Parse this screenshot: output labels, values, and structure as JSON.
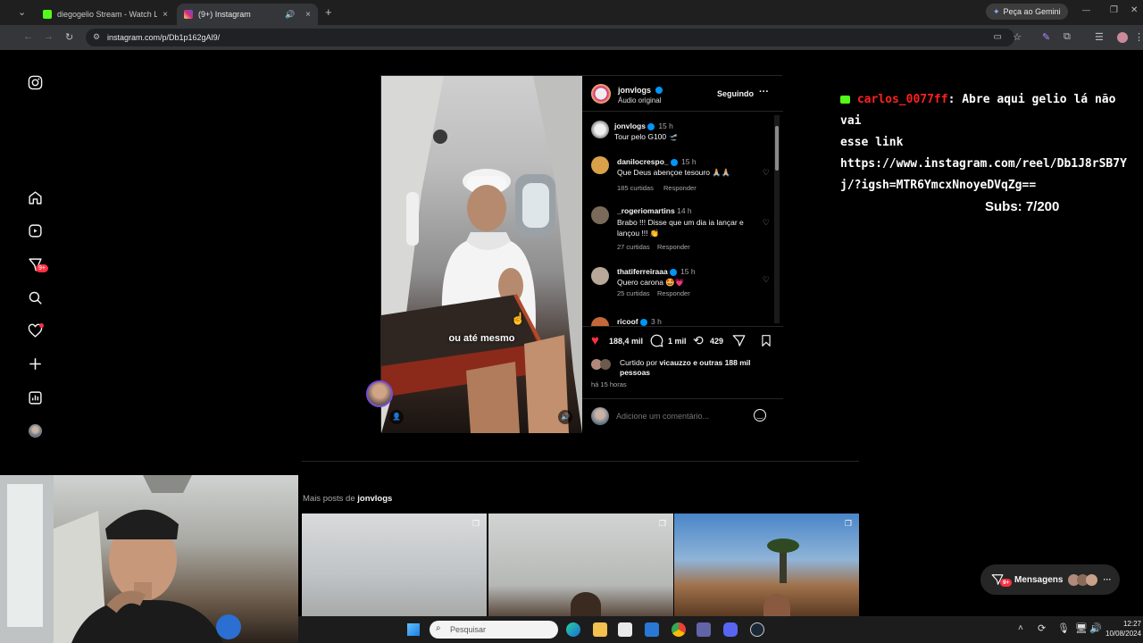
{
  "browser": {
    "tabs": [
      {
        "title": "diegogelio Stream - Watch Liv",
        "close": "×"
      },
      {
        "title": "(9+) Instagram",
        "close": "×"
      }
    ],
    "new_tab": "+",
    "gemini_button": "Peça ao Gemini",
    "url": "instagram.com/p/Db1p162gAl9/",
    "window_controls": [
      "—",
      "❐",
      "✕"
    ]
  },
  "sidebar": {
    "icons": [
      "instagram-logo-icon",
      "home-icon",
      "reels-icon",
      "direct-icon",
      "search-icon",
      "notifications-icon",
      "create-icon",
      "dashboard-icon",
      "profile-avatar-icon"
    ],
    "direct_badge": "9+"
  },
  "post": {
    "author": "jonvlogs",
    "audio": "Áudio original",
    "follow_state": "Seguindo",
    "more": "···",
    "subtitle": "ou até mesmo",
    "caption": {
      "user": "jonvlogs",
      "time": "15 h",
      "text": "Tour pelo G100 🛫"
    },
    "comments": [
      {
        "user": "danilocrespo_",
        "time": "15 h",
        "text": "Que Deus abençoe tesouro 🙏🏼🙏🏼",
        "likes": "185 curtidas",
        "reply": "Responder",
        "color": "#d8a14a"
      },
      {
        "user": "_rogeriomartins",
        "time": "14 h",
        "text": "Brabo !!! Disse que um dia ia lançar e lançou !!! 👏",
        "likes": "27 curtidas",
        "reply": "Responder",
        "color": "#7a6a5a"
      },
      {
        "user": "thatiferreiraaa",
        "time": "15 h",
        "text": "Quero carona 🤩💗",
        "likes": "25 curtidas",
        "reply": "Responder",
        "color": "#b7a899"
      },
      {
        "user": "ricoof",
        "time": "3 h",
        "text": "",
        "likes": "",
        "reply": "",
        "color": "#c4683a"
      }
    ],
    "likes_count": "188,4 mil",
    "comments_count": "1 mil",
    "reposts_count": "429",
    "liked_by_prefix": "Curtido por ",
    "liked_by_user": "vicauzzo",
    "liked_by_suffix": " e outras 188 mil pessoas",
    "posted_ago": "há 15 horas",
    "comment_placeholder": "Adicione um comentário...",
    "accent": "#ff3040",
    "verified_color": "#0095f6"
  },
  "chat_overlay": {
    "username": "carlos_0077ff",
    "message_line1": ": Abre aqui gelio lá não vai",
    "message_line2": "esse link",
    "link_line1": "https://www.instagram.com/reel/Db1J8rSB7Y",
    "link_line2": "j/?igsh=MTR6YmcxNnoyeDVqZg==",
    "subs": "Subs: 7/200",
    "username_color": "#ff2020"
  },
  "more_posts": {
    "prefix": "Mais posts de ",
    "user": "jonvlogs"
  },
  "messages_button": {
    "label": "Mensagens",
    "badge": "9+"
  },
  "taskbar": {
    "search_placeholder": "Pesquisar",
    "time": "12:27",
    "date": "10/08/2024"
  }
}
